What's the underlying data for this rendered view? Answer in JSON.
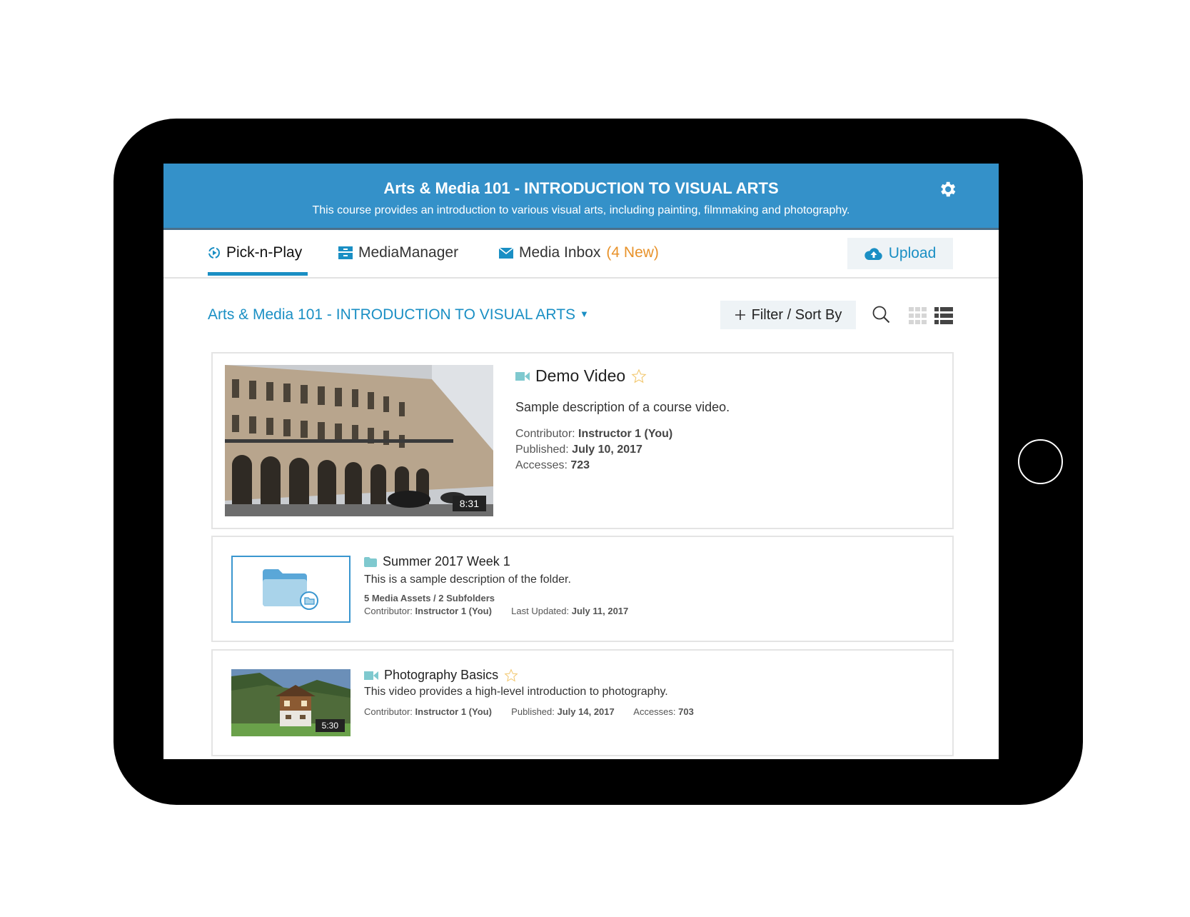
{
  "header": {
    "title": "Arts & Media 101 - INTRODUCTION TO VISUAL ARTS",
    "subtitle": "This course provides an introduction to various visual arts, including painting, filmmaking and photography."
  },
  "tabs": [
    {
      "label": "Pick-n-Play",
      "icon": "pick-n-play-icon"
    },
    {
      "label": "MediaManager",
      "icon": "media-manager-icon"
    },
    {
      "label": "Media Inbox",
      "badge": "(4 New)",
      "icon": "envelope-icon"
    }
  ],
  "upload": {
    "label": "Upload",
    "icon": "cloud-upload-icon"
  },
  "toolbar": {
    "breadcrumb": "Arts & Media 101 - INTRODUCTION TO VISUAL ARTS",
    "filter_label": "Filter / Sort By"
  },
  "items": [
    {
      "type": "video",
      "title": "Demo Video",
      "description": "Sample description of a course video.",
      "contributor_label": "Contributor:",
      "contributor": "Instructor 1 (You)",
      "published_label": "Published:",
      "published": "July 10, 2017",
      "accesses_label": "Accesses:",
      "accesses": "723",
      "duration": "8:31"
    },
    {
      "type": "folder",
      "title": "Summer 2017 Week 1",
      "description": "This is a sample description of the folder.",
      "counts": "5 Media Assets / 2 Subfolders",
      "contributor_label": "Contributor:",
      "contributor": "Instructor 1 (You)",
      "updated_label": "Last Updated:",
      "updated": "July 11, 2017"
    },
    {
      "type": "video",
      "title": "Photography Basics",
      "description": "This video provides a high-level introduction to photography.",
      "contributor_label": "Contributor:",
      "contributor": "Instructor 1 (You)",
      "published_label": "Published:",
      "published": "July 14, 2017",
      "accesses_label": "Accesses:",
      "accesses": "703",
      "duration": "5:30"
    }
  ],
  "colors": {
    "header_bg": "#3491c9",
    "accent": "#1a8fc4",
    "new_badge": "#e8922a"
  }
}
